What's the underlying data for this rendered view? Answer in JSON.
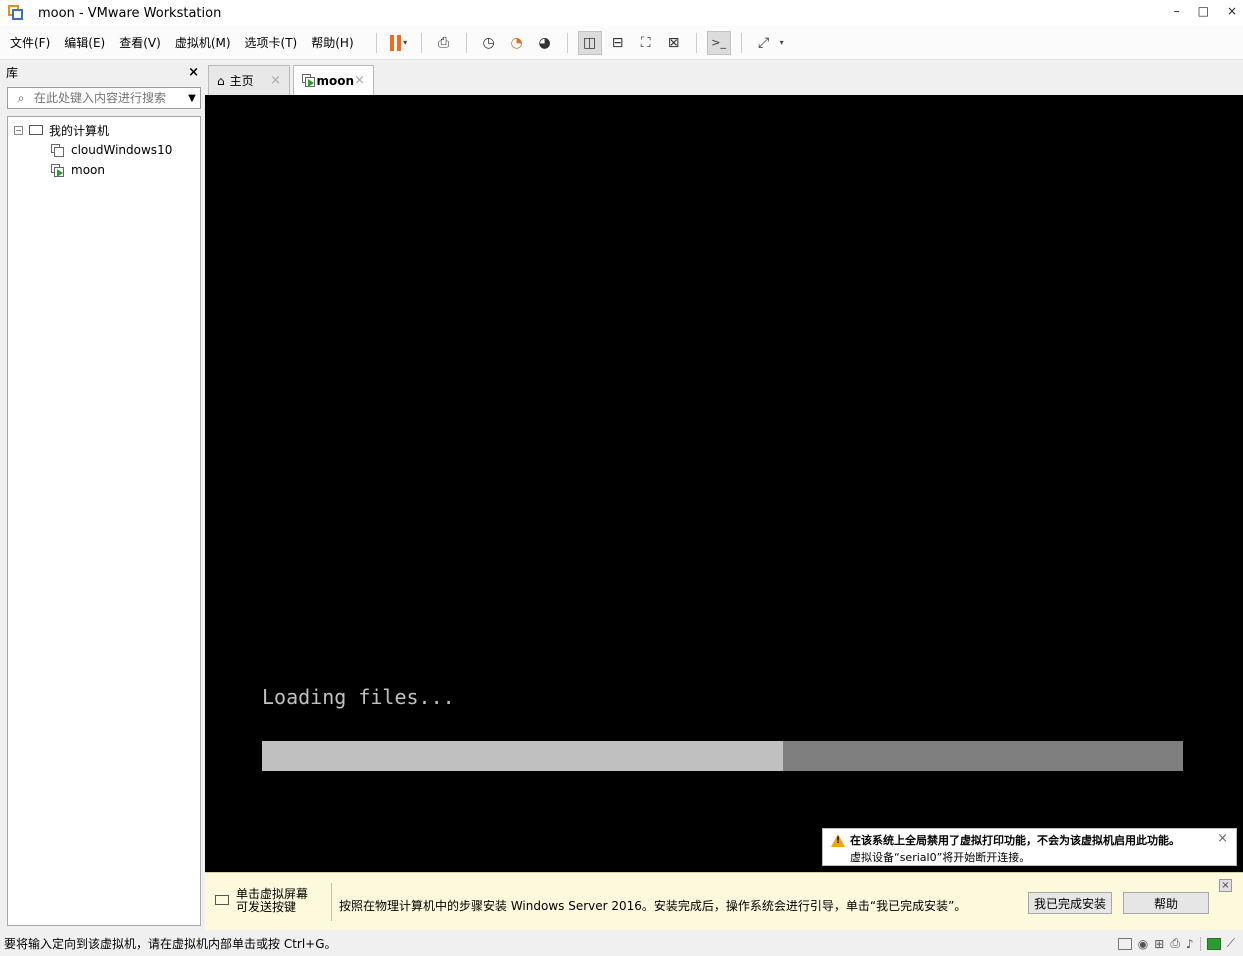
{
  "window": {
    "title": "moon - VMware Workstation",
    "minimize": "–",
    "maximize": "□",
    "close": "×"
  },
  "menu": {
    "items": [
      "文件(F)",
      "编辑(E)",
      "查看(V)",
      "虚拟机(M)",
      "选项卡(T)",
      "帮助(H)"
    ]
  },
  "toolbar": {
    "icons": [
      "pause-icon",
      "send-ctrl-alt-del-icon",
      "snapshot-take-icon",
      "snapshot-revert-icon",
      "snapshot-manager-icon",
      "show-library-icon",
      "show-thumbnail-icon",
      "full-screen-icon",
      "unity-icon",
      "console-icon",
      "stretch-icon"
    ],
    "pause_color": "#f26b1d",
    "caret": "▾"
  },
  "library": {
    "title": "库",
    "close": "×",
    "search_placeholder": "在此处键入内容进行搜索",
    "search_icon": "⌕",
    "dropdown": "▼",
    "tree": {
      "root": {
        "label": "我的计算机",
        "expander": "⊟"
      },
      "children": [
        {
          "label": "cloudWindows10"
        },
        {
          "label": "moon"
        }
      ]
    }
  },
  "tabs": [
    {
      "label": "主页",
      "icon": "⌂",
      "close": "×"
    },
    {
      "label": "moon",
      "close": "×"
    }
  ],
  "vm_screen": {
    "text": "Loading files...",
    "progress_fraction": 0.566,
    "bg_color": "#000000",
    "fill_color": "#c0c0c0"
  },
  "notification": {
    "line1": "在该系统上全局禁用了虚拟打印功能，不会为该虚拟机启用此功能。",
    "line2": "虚拟设备“serial0”将开始断开连接。",
    "close": "×"
  },
  "hint_bar": {
    "kb_text_line1": "单击虚拟屏幕",
    "kb_text_line2": "可发送按键",
    "message": "按照在物理计算机中的步骤安装 Windows Server 2016。安装完成后，操作系统会进行引导，单击“我已完成安装”。",
    "done_button": "我已完成安装",
    "help_button": "帮助",
    "close": "×"
  },
  "status": {
    "text": "要将输入定向到该虚拟机，请在虚拟机内部单击或按 Ctrl+G。"
  }
}
